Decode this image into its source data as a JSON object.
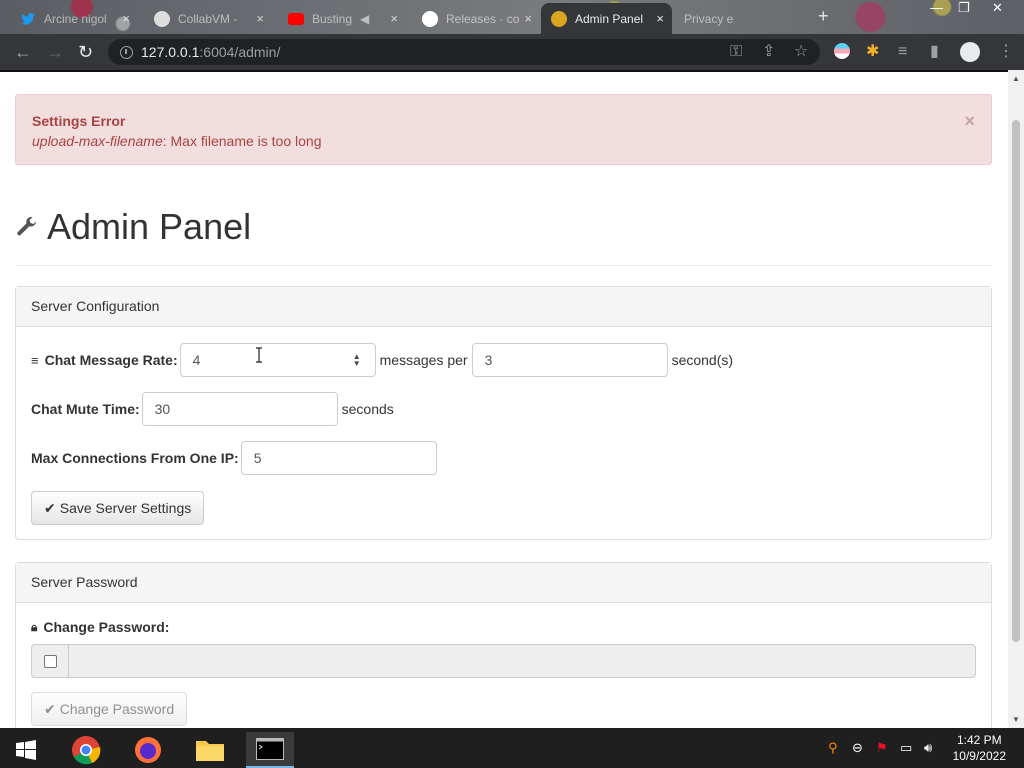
{
  "browser": {
    "tabs": [
      {
        "title": "Arcine nigol",
        "active": false
      },
      {
        "title": "CollabVM -",
        "active": false
      },
      {
        "title": "Busting",
        "active": false
      },
      {
        "title": "Releases · co",
        "active": false
      },
      {
        "title": "Admin Panel",
        "active": true
      },
      {
        "title": "Privacy e",
        "active": false
      }
    ],
    "new_tab": "+",
    "url_host": "127.0.0.1",
    "url_path": ":6004/admin/"
  },
  "alert": {
    "title": "Settings Error",
    "field": "upload-max-filename",
    "message": ": Max filename is too long",
    "close": "×"
  },
  "page": {
    "title": "Admin Panel"
  },
  "server_config": {
    "heading": "Server Configuration",
    "chat_rate_label": "Chat Message Rate:",
    "chat_rate_messages": "4",
    "chat_rate_mid": "messages per",
    "chat_rate_seconds": "3",
    "chat_rate_unit": "second(s)",
    "mute_label": "Chat Mute Time:",
    "mute_value": "30",
    "mute_unit": "seconds",
    "max_conn_label": "Max Connections From One IP:",
    "max_conn_value": "5",
    "save_button": "Save Server Settings"
  },
  "server_password": {
    "heading": "Server Password",
    "change_label": "Change Password:",
    "change_button": "Change Password"
  },
  "taskbar": {
    "time": "1:42 PM",
    "date": "10/9/2022"
  }
}
